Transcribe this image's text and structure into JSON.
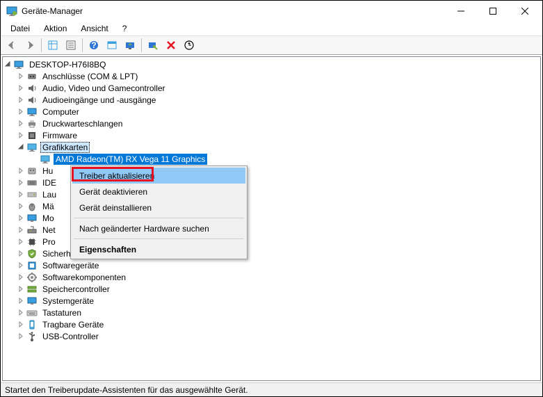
{
  "window": {
    "title": "Geräte-Manager"
  },
  "menu": {
    "items": [
      "Datei",
      "Aktion",
      "Ansicht",
      "?"
    ]
  },
  "root": {
    "name": "DESKTOP-H76I8BQ"
  },
  "categories": [
    {
      "label": "Anschlüsse (COM & LPT)",
      "icon": "port",
      "expanded": false
    },
    {
      "label": "Audio, Video und Gamecontroller",
      "icon": "audio",
      "expanded": false
    },
    {
      "label": "Audioeingänge und -ausgänge",
      "icon": "audio",
      "expanded": false
    },
    {
      "label": "Computer",
      "icon": "computer",
      "expanded": false
    },
    {
      "label": "Druckwarteschlangen",
      "icon": "printer",
      "expanded": false
    },
    {
      "label": "Firmware",
      "icon": "firmware",
      "expanded": false
    },
    {
      "label": "Grafikkarten",
      "icon": "display",
      "expanded": true,
      "child": "AMD Radeon(TM) RX Vega 11 Graphics"
    },
    {
      "label": "Hu",
      "icon": "hid",
      "expanded": false
    },
    {
      "label": "IDE",
      "icon": "ide",
      "expanded": false
    },
    {
      "label": "Lau",
      "icon": "drive",
      "expanded": false
    },
    {
      "label": "Mä",
      "icon": "mouse",
      "expanded": false
    },
    {
      "label": "Mo",
      "icon": "monitor",
      "expanded": false
    },
    {
      "label": "Net",
      "icon": "network",
      "expanded": false
    },
    {
      "label": "Pro",
      "icon": "cpu",
      "expanded": false
    },
    {
      "label": "Sicherheitsgeräte",
      "icon": "security",
      "expanded": false
    },
    {
      "label": "Softwaregeräte",
      "icon": "software",
      "expanded": false
    },
    {
      "label": "Softwarekomponenten",
      "icon": "component",
      "expanded": false
    },
    {
      "label": "Speichercontroller",
      "icon": "storage",
      "expanded": false
    },
    {
      "label": "Systemgeräte",
      "icon": "system",
      "expanded": false
    },
    {
      "label": "Tastaturen",
      "icon": "keyboard",
      "expanded": false
    },
    {
      "label": "Tragbare Geräte",
      "icon": "portable",
      "expanded": false
    },
    {
      "label": "USB-Controller",
      "icon": "usb",
      "expanded": false
    }
  ],
  "context_menu": {
    "items": [
      {
        "label": "Treiber aktualisieren",
        "highlighted": true
      },
      {
        "label": "Gerät deaktivieren"
      },
      {
        "label": "Gerät deinstallieren"
      },
      {
        "sep": true
      },
      {
        "label": "Nach geänderter Hardware suchen"
      },
      {
        "sep": true
      },
      {
        "label": "Eigenschaften",
        "bold": true
      }
    ]
  },
  "status": "Startet den Treiberupdate-Assistenten für das ausgewählte Gerät."
}
